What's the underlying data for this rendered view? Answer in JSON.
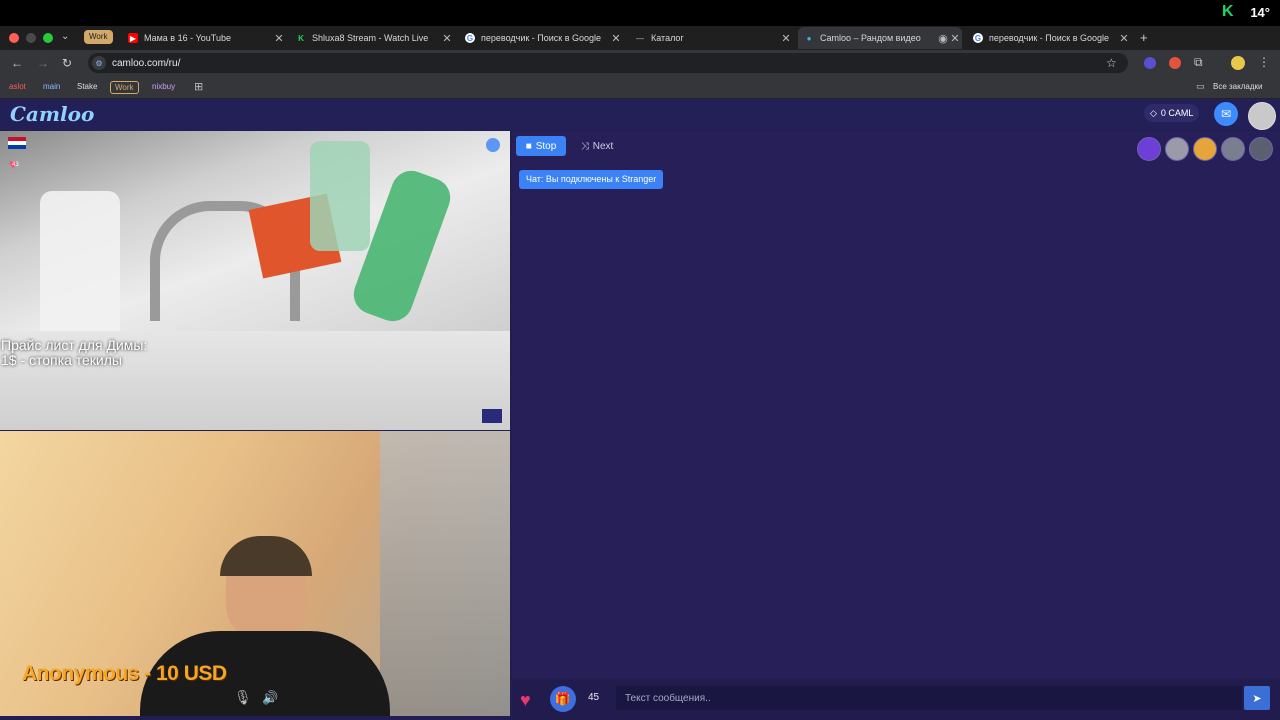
{
  "os": {
    "status_k": "K",
    "status_num": "14°"
  },
  "browser": {
    "tab_group_label": "Work",
    "tabs": [
      {
        "label": "Мама в 16 - YouTube",
        "fav": "▶",
        "fav_color": "#ff0000"
      },
      {
        "label": "Shluxa8 Stream - Watch Live",
        "fav": "K",
        "fav_color": "#1ed760"
      },
      {
        "label": "переводчик - Поиск в Google",
        "fav": "G",
        "fav_color": "#4285f4"
      },
      {
        "label": "Каталог",
        "fav": "—",
        "fav_color": "#444444"
      },
      {
        "label": "Camloo – Рандом видео",
        "fav": "●",
        "fav_color": "#33b5e5"
      },
      {
        "label": "переводчик - Поиск в Google",
        "fav": "G",
        "fav_color": "#4285f4"
      }
    ],
    "url": "camloo.com/ru/",
    "bookmarks": [
      {
        "label": "aslot",
        "color": "#ff5a5a",
        "bg": "transparent"
      },
      {
        "label": "main",
        "color": "#8fb8ff",
        "bg": "transparent"
      },
      {
        "label": "Stake",
        "color": "#dddddd",
        "bg": "transparent"
      },
      {
        "label": "Work",
        "color": "#d3a96a",
        "bg": "transparent"
      },
      {
        "label": "nixbuy",
        "color": "#c9a0ff",
        "bg": "transparent"
      }
    ],
    "all_bookmarks": "Все закладки"
  },
  "site": {
    "logo": "Camloo",
    "balance": "0 CAML",
    "remote_video": {
      "like_count": "43",
      "price_line1": "Прайс лист для Димы:",
      "price_line2": "1$ - стопка текилы"
    },
    "local_video": {
      "donation": "Anonymous - 10 USD"
    },
    "controls": {
      "stop": "Stop",
      "next": "Next"
    },
    "system_message": "Чат: Вы подключены к Stranger",
    "bottom": {
      "count": "45",
      "placeholder": "Текст сообщения.."
    }
  }
}
